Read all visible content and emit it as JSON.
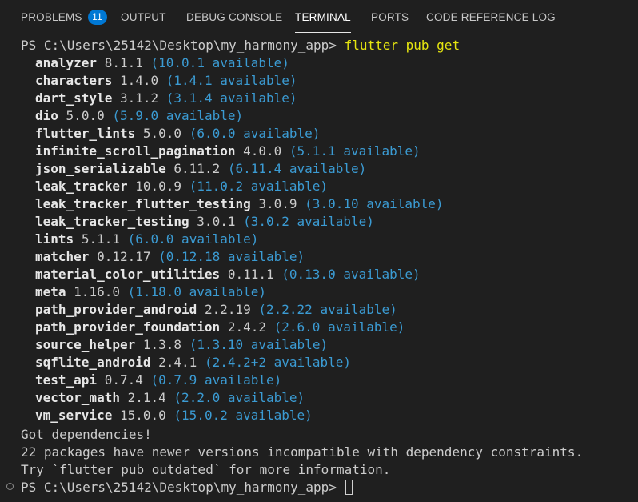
{
  "tabs": [
    {
      "label": "PROBLEMS",
      "badge": "11"
    },
    {
      "label": "OUTPUT"
    },
    {
      "label": "DEBUG CONSOLE"
    },
    {
      "label": "TERMINAL",
      "active": true
    },
    {
      "label": "PORTS"
    },
    {
      "label": "CODE REFERENCE LOG"
    }
  ],
  "terminal": {
    "prompt": "PS C:\\Users\\25142\\Desktop\\my_harmony_app> ",
    "command": "flutter pub get",
    "packages": [
      {
        "name": "analyzer",
        "version": "8.1.1",
        "available": "(10.0.1 available)"
      },
      {
        "name": "characters",
        "version": "1.4.0",
        "available": "(1.4.1 available)"
      },
      {
        "name": "dart_style",
        "version": "3.1.2",
        "available": "(3.1.4 available)"
      },
      {
        "name": "dio",
        "version": "5.0.0",
        "available": "(5.9.0 available)"
      },
      {
        "name": "flutter_lints",
        "version": "5.0.0",
        "available": "(6.0.0 available)"
      },
      {
        "name": "infinite_scroll_pagination",
        "version": "4.0.0",
        "available": "(5.1.1 available)"
      },
      {
        "name": "json_serializable",
        "version": "6.11.2",
        "available": "(6.11.4 available)"
      },
      {
        "name": "leak_tracker",
        "version": "10.0.9",
        "available": "(11.0.2 available)"
      },
      {
        "name": "leak_tracker_flutter_testing",
        "version": "3.0.9",
        "available": "(3.0.10 available)"
      },
      {
        "name": "leak_tracker_testing",
        "version": "3.0.1",
        "available": "(3.0.2 available)"
      },
      {
        "name": "lints",
        "version": "5.1.1",
        "available": "(6.0.0 available)"
      },
      {
        "name": "matcher",
        "version": "0.12.17",
        "available": "(0.12.18 available)"
      },
      {
        "name": "material_color_utilities",
        "version": "0.11.1",
        "available": "(0.13.0 available)"
      },
      {
        "name": "meta",
        "version": "1.16.0",
        "available": "(1.18.0 available)"
      },
      {
        "name": "path_provider_android",
        "version": "2.2.19",
        "available": "(2.2.22 available)"
      },
      {
        "name": "path_provider_foundation",
        "version": "2.4.2",
        "available": "(2.6.0 available)"
      },
      {
        "name": "source_helper",
        "version": "1.3.8",
        "available": "(1.3.10 available)"
      },
      {
        "name": "sqflite_android",
        "version": "2.4.1",
        "available": "(2.4.2+2 available)"
      },
      {
        "name": "test_api",
        "version": "0.7.4",
        "available": "(0.7.9 available)"
      },
      {
        "name": "vector_math",
        "version": "2.1.4",
        "available": "(2.2.0 available)"
      },
      {
        "name": "vm_service",
        "version": "15.0.0",
        "available": "(15.0.2 available)"
      }
    ],
    "summary": [
      "Got dependencies!",
      "22 packages have newer versions incompatible with dependency constraints.",
      "Try `flutter pub outdated` for more information."
    ],
    "final_prompt": "PS C:\\Users\\25142\\Desktop\\my_harmony_app> "
  },
  "colors": {
    "background": "#1f1f1f",
    "command": "#e5e510",
    "available": "#3b9bd3",
    "badge": "#0078d4"
  }
}
